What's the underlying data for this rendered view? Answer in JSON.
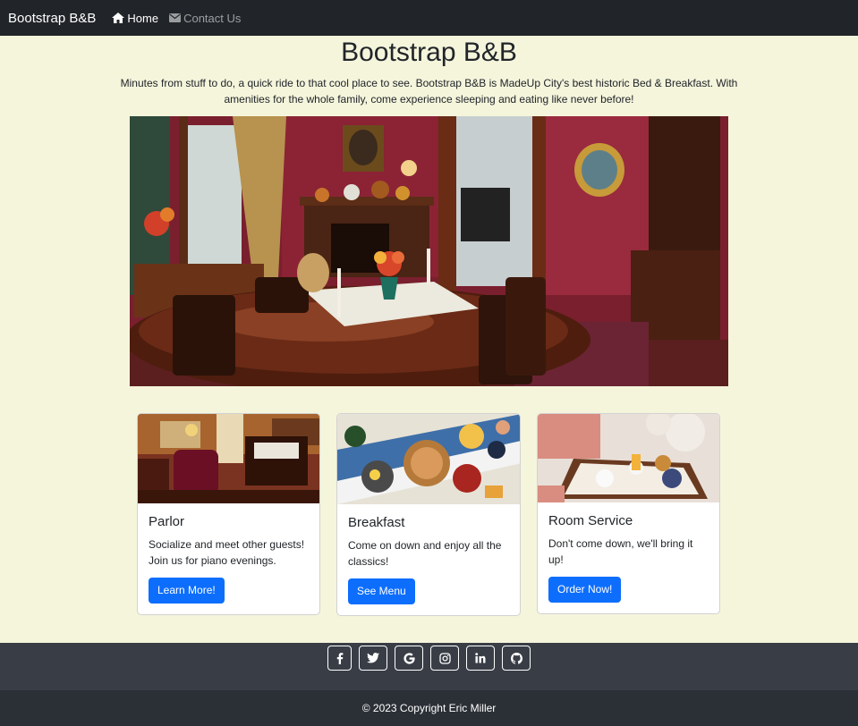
{
  "navbar": {
    "brand": "Bootstrap B&B",
    "links": [
      {
        "label": "Home",
        "icon": "home-icon",
        "active": true
      },
      {
        "label": "Contact Us",
        "icon": "envelope-icon",
        "active": false
      }
    ]
  },
  "hero": {
    "title": "Bootstrap B&B",
    "lead": "Minutes from stuff to do, a quick ride to that cool place to see. Bootstrap B&B is MadeUp City's best historic Bed & Breakfast. With amenities for the whole family, come experience sleeping and eating like never before!"
  },
  "cards": [
    {
      "title": "Parlor",
      "text": "Socialize and meet other guests! Join us for piano evenings.",
      "button": "Learn More!"
    },
    {
      "title": "Breakfast",
      "text": "Come on down and enjoy all the classics!",
      "button": "See Menu"
    },
    {
      "title": "Room Service",
      "text": "Don't come down, we'll bring it up!",
      "button": "Order Now!"
    }
  ],
  "footer": {
    "social": [
      "facebook-icon",
      "twitter-icon",
      "google-icon",
      "instagram-icon",
      "linkedin-icon",
      "github-icon"
    ],
    "copyright": "© 2023 Copyright Eric Miller"
  },
  "colors": {
    "background": "#f5f5dc",
    "navbar": "#212529",
    "primary_button": "#0d6efd",
    "footer_top": "#393e46",
    "footer_bottom": "#2b3036"
  }
}
